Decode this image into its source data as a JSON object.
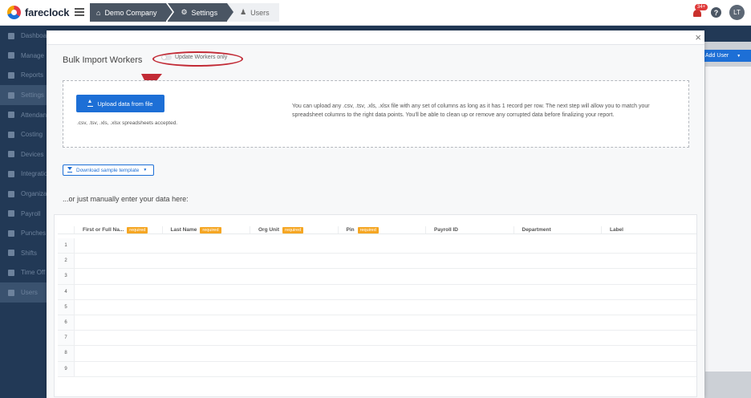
{
  "app": {
    "logo_text": "fareclock",
    "logo_icon": "fareclock-logo-icon"
  },
  "breadcrumb": [
    {
      "label": "Demo Company",
      "icon": "home-icon"
    },
    {
      "label": "Settings",
      "icon": "gear-icon"
    },
    {
      "label": "Users",
      "icon": "users-icon"
    }
  ],
  "header": {
    "notification_count": "34+",
    "help_label": "?",
    "avatar_initials": "LT"
  },
  "sidebar": {
    "items": [
      {
        "label": "Dashboard",
        "icon": "dashboard-icon"
      },
      {
        "label": "Manage",
        "icon": "person-icon"
      },
      {
        "label": "Reports",
        "icon": "chart-icon"
      },
      {
        "label": "Settings",
        "icon": "gear-icon"
      },
      {
        "label": "Attendance",
        "icon": "calendar-icon"
      },
      {
        "label": "Costing",
        "icon": "costing-icon"
      },
      {
        "label": "Devices",
        "icon": "device-icon"
      },
      {
        "label": "Integrations",
        "icon": "plug-icon"
      },
      {
        "label": "Organization",
        "icon": "org-icon"
      },
      {
        "label": "Payroll",
        "icon": "payroll-icon"
      },
      {
        "label": "Punches",
        "icon": "punch-icon"
      },
      {
        "label": "Shifts",
        "icon": "shifts-icon"
      },
      {
        "label": "Time Off",
        "icon": "timeoff-icon"
      },
      {
        "label": "Users",
        "icon": "users-icon"
      }
    ]
  },
  "background": {
    "add_user_label": "Add User"
  },
  "modal": {
    "close_label": "×",
    "title": "Bulk Import Workers",
    "toggle_label": "Update Workers only",
    "upload_button": "Upload data from file",
    "accepted_note": ".csv, .tsv, .xls, .xlsx spreadsheets accepted.",
    "description": "You can upload any .csv, .tsv, .xls, .xlsx file with any set of columns as long as it has 1 record per row. The next step will allow you to match your spreadsheet columns to the right data points. You'll be able to clean up or remove any corrupted data before finalizing your report.",
    "sample_button": "Download sample template",
    "manual_text": "...or just manually enter your data here:",
    "required_label": "required",
    "columns": [
      {
        "label": "First or Full Na...",
        "required": true
      },
      {
        "label": "Last Name",
        "required": true
      },
      {
        "label": "Org Unit",
        "required": true
      },
      {
        "label": "Pin",
        "required": true
      },
      {
        "label": "Payroll ID",
        "required": false
      },
      {
        "label": "Department",
        "required": false
      },
      {
        "label": "Label",
        "required": false
      }
    ],
    "row_numbers": [
      "1",
      "2",
      "3",
      "4",
      "5",
      "6",
      "7",
      "8",
      "9"
    ]
  },
  "colors": {
    "accent": "#1d6fd6",
    "sidebar": "#223956",
    "required_badge": "#f5a623",
    "annotation": "#c22b36"
  }
}
